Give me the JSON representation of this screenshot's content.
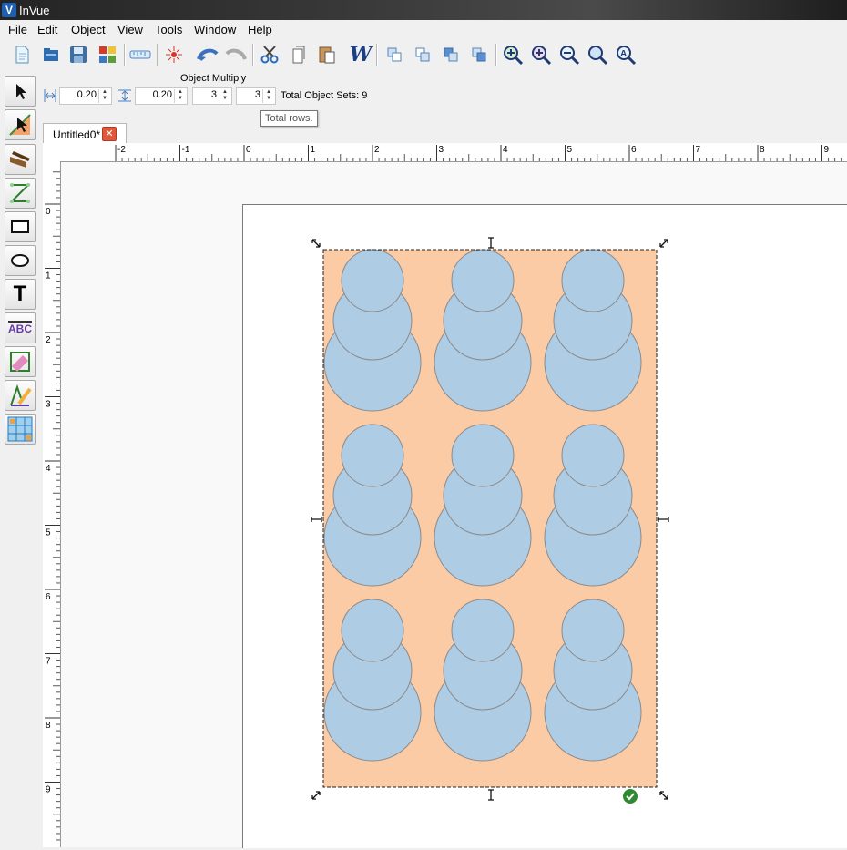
{
  "window": {
    "title": "InVue",
    "logo_letter": "V"
  },
  "menu": [
    "File",
    "Edit",
    "Object",
    "View",
    "Tools",
    "Window",
    "Help"
  ],
  "toolbar_icons": [
    "new-file-icon",
    "open-folder-icon",
    "save-icon",
    "color-palette-icon",
    "ruler-icon",
    "trace-icon",
    "undo-icon",
    "redo-icon",
    "scissors-icon",
    "copy-icon",
    "paste-icon",
    "wordart-icon",
    "arrange-front-icon",
    "arrange-forward-icon",
    "arrange-backward-icon",
    "arrange-back-icon",
    "zoom-fit-icon",
    "zoom-in-icon",
    "zoom-out-icon",
    "zoom-page-icon",
    "zoom-all-icon"
  ],
  "toolbar": {
    "wordart_letter": "W"
  },
  "tools": [
    "select-tool-icon",
    "node-edit-tool-icon",
    "knife-tool-icon",
    "line-tool-icon",
    "rectangle-tool-icon",
    "ellipse-tool-icon",
    "text-tool-icon",
    "text-on-path-tool-icon",
    "eraser-tool-icon",
    "pen-tool-icon",
    "object-multiply-tool-icon"
  ],
  "tool_labels": {
    "text_tool": "T",
    "abc_tool": "ABC"
  },
  "object_multiply": {
    "title": "Object Multiply",
    "horizontal_spacing": "0.20",
    "vertical_spacing": "0.20",
    "columns": "3",
    "rows": "3",
    "total_label": "Total Object Sets: 9",
    "tooltip": "Total rows."
  },
  "document": {
    "tab_label": "Untitled0*",
    "close_glyph": "✕"
  },
  "ruler": {
    "h_labels": [
      "-2",
      "-1",
      "0",
      "1",
      "2",
      "3",
      "4",
      "5",
      "6",
      "7",
      "8",
      "9"
    ],
    "v_labels": [
      "0",
      "1",
      "2",
      "3",
      "4",
      "5",
      "6",
      "7",
      "8",
      "9"
    ]
  },
  "design": {
    "background_color": "#fbcba6",
    "circle_color": "#aecce4",
    "grid_columns": 3,
    "grid_rows": 3
  }
}
